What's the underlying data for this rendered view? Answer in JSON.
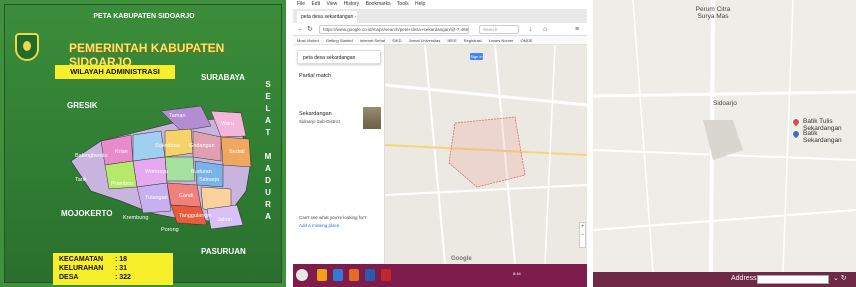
{
  "poster": {
    "header": "PETA KABUPATEN SIDOARJO",
    "government": "PEMERINTAH KABUPATEN SIDOARJO",
    "section": "WILAYAH ADMINISTRASI",
    "neighbors": {
      "surabaya": "SURABAYA",
      "gresik": "GRESIK",
      "mojokerto": "MOJOKERTO",
      "pasuruan": "PASURUAN"
    },
    "strait_letters": [
      "S",
      "E",
      "L",
      "A",
      "T",
      "",
      "M",
      "A",
      "D",
      "U",
      "R",
      "A"
    ],
    "districts": [
      "Taman",
      "Waru",
      "Sukodono",
      "Gedangan",
      "Sedati",
      "Balongbendo",
      "Krian",
      "Wonoayu",
      "Buduran",
      "Tarik",
      "Prambon",
      "Sidoarjo",
      "Tulangan",
      "Candi",
      "Krembung",
      "Tanggulangin",
      "Porong",
      "Jabon"
    ],
    "stats": [
      {
        "label": "KECAMATAN",
        "value": ": 18"
      },
      {
        "label": "KELURAHAN",
        "value": ": 31"
      },
      {
        "label": "DESA",
        "value": ": 322"
      }
    ],
    "colors": {
      "background": "#3b8c3a",
      "highlight": "#f7ef2a",
      "title": "#f6e66b"
    }
  },
  "browser": {
    "menu": [
      "File",
      "Edit",
      "View",
      "History",
      "Bookmarks",
      "Tools",
      "Help"
    ],
    "tab_title": "peta desa sekardangan - Goo...",
    "url": "https://www.google.co.id/maps/search/peta+desa+sekardangan/@-7.4662...",
    "search_placeholder": "Search",
    "bookmarks": [
      "Most Visited",
      "Getting Started",
      "Internet Sehat",
      "SIKD",
      "Jurnal Universitas",
      "IEEE",
      "Registrasi",
      "Luwes Nomer",
      "OMDE"
    ],
    "maps_search": "peta desa sekardangan",
    "partial_match": "Partial match",
    "result_subtitle": "Sekardangan",
    "result_desc": "Sidoarjo Sub-District",
    "sign_in": "Sign in",
    "missing_place": "Can't see what you're looking for?",
    "add_place": "Add a missing place",
    "google": "Google",
    "taskbar_time": "8:44",
    "taskbar_color": "#7e1c4c"
  },
  "map": {
    "place_top": "Perum Citra Surya Mas",
    "center": "Sidoarjo",
    "pins": [
      {
        "label": "Batik Tulis Sekardangan",
        "color": "#d94a4a"
      },
      {
        "label": "Batik Sekardangan",
        "color": "#3a6fc4"
      }
    ],
    "address_label": "Address",
    "address_bar_color": "#6d2946"
  }
}
